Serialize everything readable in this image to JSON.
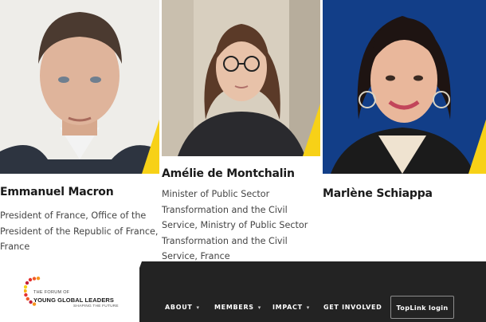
{
  "leaders": [
    {
      "name": "Emmanuel Macron",
      "role": "President of France, Office of the President of the Republic of France, France"
    },
    {
      "name": "Amélie de Montchalin",
      "role": "Minister of Public Sector Transformation and the Civil Service, Ministry of Public Sector Transformation and the Civil Service, France"
    },
    {
      "name": "Marlène Schiappa",
      "role": ""
    }
  ],
  "logo": {
    "line1": "THE FORUM OF",
    "line2": "YOUNG GLOBAL LEADERS",
    "line3": "SHAPING THE FUTURE"
  },
  "nav": {
    "items": [
      "ABOUT",
      "MEMBERS",
      "IMPACT",
      "GET INVOLVED"
    ],
    "dropdown_caret_icon": "chevron-down-icon",
    "toplink_label": "TopLink login"
  },
  "colors": {
    "accent_yellow": "#f7d117",
    "footer_dark": "#232323",
    "text_dark": "#1a1a1a",
    "text_muted": "#444444"
  }
}
